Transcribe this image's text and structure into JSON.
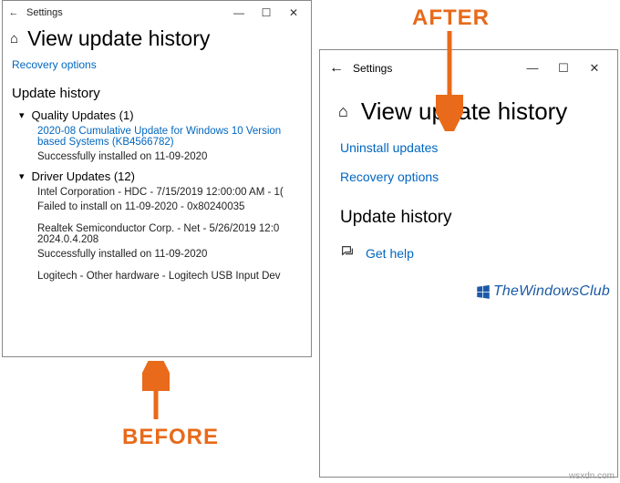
{
  "labels": {
    "before": "BEFORE",
    "after": "AFTER"
  },
  "left": {
    "app_title": "Settings",
    "page_title": "View update history",
    "recovery_link": "Recovery options",
    "section": "Update history",
    "cat_quality": "Quality Updates (1)",
    "quality_item": "2020-08 Cumulative Update for Windows 10 Version based Systems (KB4566782)",
    "quality_status": "Successfully installed on 11-09-2020",
    "cat_driver": "Driver Updates (12)",
    "driver1": "Intel Corporation - HDC - 7/15/2019 12:00:00 AM - 1(",
    "driver1_status": "Failed to install on 11-09-2020 - 0x80240035",
    "driver2": "Realtek Semiconductor Corp. - Net - 5/26/2019 12:0 2024.0.4.208",
    "driver2_status": "Successfully installed on 11-09-2020",
    "driver3": "Logitech - Other hardware - Logitech USB Input Dev"
  },
  "right": {
    "app_title": "Settings",
    "page_title": "View update history",
    "uninstall_link": "Uninstall updates",
    "recovery_link": "Recovery options",
    "section": "Update history",
    "get_help": "Get help"
  },
  "watermark": "TheWindowsClub",
  "attribution": "wsxdn.com"
}
